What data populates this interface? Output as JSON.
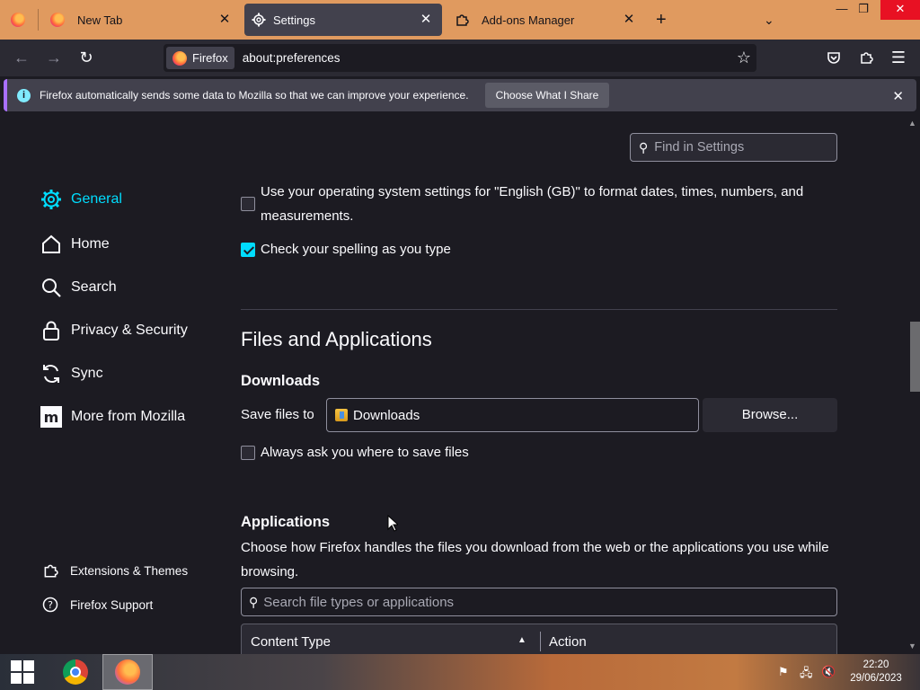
{
  "tabs": [
    {
      "title": "New Tab",
      "icon": "firefox-icon",
      "active": false
    },
    {
      "title": "Settings",
      "icon": "gear-icon",
      "active": true
    },
    {
      "title": "Add-ons Manager",
      "icon": "puzzle-icon",
      "active": false
    }
  ],
  "navbar": {
    "identity_label": "Firefox",
    "url": "about:preferences"
  },
  "notification": {
    "text": "Firefox automatically sends some data to Mozilla so that we can improve your experience.",
    "button_label": "Choose What I Share"
  },
  "search": {
    "placeholder": "Find in Settings"
  },
  "sidebar": {
    "items": [
      {
        "label": "General",
        "icon": "gear-icon",
        "active": true
      },
      {
        "label": "Home",
        "icon": "home-icon"
      },
      {
        "label": "Search",
        "icon": "search-icon"
      },
      {
        "label": "Privacy & Security",
        "icon": "lock-icon"
      },
      {
        "label": "Sync",
        "icon": "sync-icon"
      },
      {
        "label": "More from Mozilla",
        "icon": "mozilla-icon"
      }
    ],
    "footer": [
      {
        "label": "Extensions & Themes",
        "icon": "puzzle-icon"
      },
      {
        "label": "Firefox Support",
        "icon": "help-icon"
      }
    ]
  },
  "language": {
    "os_format_label_line1": "Use your operating system settings for \"English (GB)\" to format dates, times, numbers, and",
    "os_format_label_line2": "measurements.",
    "os_format_checked": false,
    "spell_label": "Check your spelling as you type",
    "spell_checked": true
  },
  "files": {
    "section_title": "Files and Applications",
    "downloads_title": "Downloads",
    "save_to_label": "Save files to",
    "save_to_value": "Downloads",
    "browse_label": "Browse...",
    "always_ask_label": "Always ask you where to save files",
    "always_ask_checked": false
  },
  "applications": {
    "title": "Applications",
    "description_line1": "Choose how Firefox handles the files you download from the web or the applications you use while",
    "description_line2": "browsing.",
    "search_placeholder": "Search file types or applications",
    "columns": [
      "Content Type",
      "Action"
    ]
  },
  "taskbar": {
    "time": "22:20",
    "date": "29/06/2023"
  },
  "colors": {
    "tabstrip": "#e09a5f",
    "accent": "#00ddff",
    "background": "#1c1b22"
  }
}
